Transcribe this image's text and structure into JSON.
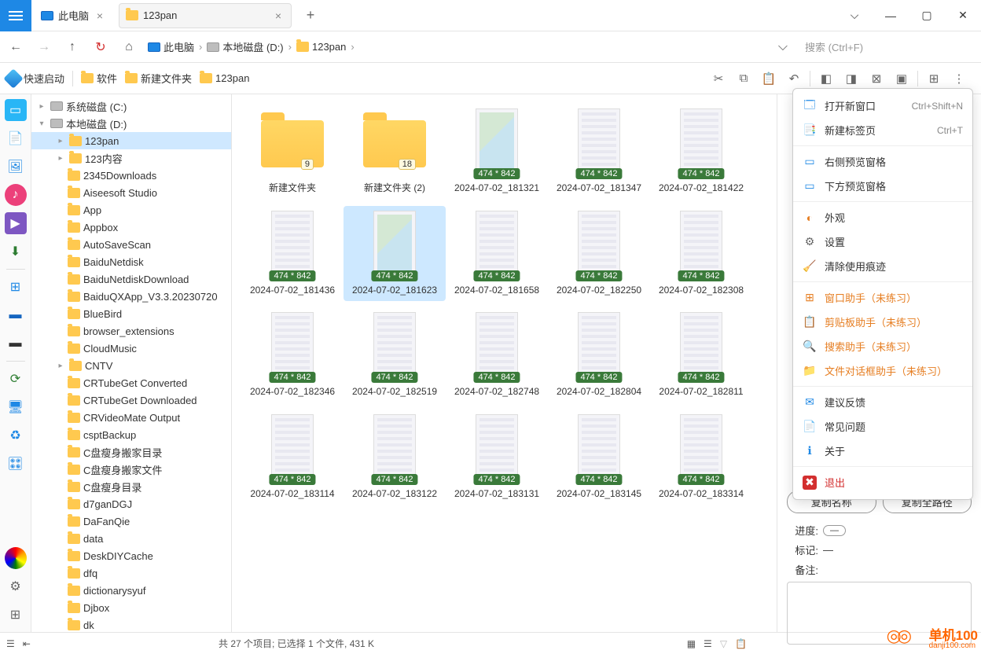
{
  "tabs": [
    {
      "label": "此电脑",
      "icon": "pc"
    },
    {
      "label": "123pan",
      "icon": "folder",
      "active": true
    }
  ],
  "nav": {
    "back": "←",
    "forward": "→",
    "up": "↑",
    "refresh": "↻",
    "home": "⌂"
  },
  "breadcrumb": [
    {
      "label": "此电脑",
      "icon": "pc"
    },
    {
      "label": "本地磁盘 (D:)",
      "icon": "disk"
    },
    {
      "label": "123pan",
      "icon": "folder"
    }
  ],
  "search_placeholder": "搜索 (Ctrl+F)",
  "quick": {
    "launch": "快速启动",
    "items": [
      "软件",
      "新建文件夹",
      "123pan"
    ]
  },
  "tree": {
    "sys_disk": "系统磁盘 (C:)",
    "local_disk": "本地磁盘 (D:)",
    "folders": [
      "123pan",
      "123内容",
      "2345Downloads",
      "Aiseesoft Studio",
      "App",
      "Appbox",
      "AutoSaveScan",
      "BaiduNetdisk",
      "BaiduNetdiskDownload",
      "BaiduQXApp_V3.3.20230720",
      "BlueBird",
      "browser_extensions",
      "CloudMusic",
      "CNTV",
      "CRTubeGet Converted",
      "CRTubeGet Downloaded",
      "CRVideoMate Output",
      "csptBackup",
      "C盘瘦身搬家目录",
      "C盘瘦身搬家文件",
      "C盘瘦身目录",
      "d7ganDGJ",
      "DaFanQie",
      "data",
      "DeskDIYCache",
      "dfq",
      "dictionarysyuf",
      "Djbox",
      "dk"
    ]
  },
  "items": [
    {
      "type": "folder",
      "name": "新建文件夹",
      "count": 9
    },
    {
      "type": "folder",
      "name": "新建文件夹 (2)",
      "count": 18
    },
    {
      "type": "img",
      "name": "2024-07-02_181321",
      "badge": "474 * 842",
      "variant": "map"
    },
    {
      "type": "img",
      "name": "2024-07-02_181347",
      "badge": "474 * 842"
    },
    {
      "type": "img",
      "name": "2024-07-02_181422",
      "badge": "474 * 842"
    },
    {
      "type": "img",
      "name": "2024-07-02_181436",
      "badge": "474 * 842"
    },
    {
      "type": "img",
      "name": "2024-07-02_181623",
      "badge": "474 * 842",
      "variant": "map",
      "selected": true
    },
    {
      "type": "img",
      "name": "2024-07-02_181658",
      "badge": "474 * 842"
    },
    {
      "type": "img",
      "name": "2024-07-02_182250",
      "badge": "474 * 842"
    },
    {
      "type": "img",
      "name": "2024-07-02_182308",
      "badge": "474 * 842"
    },
    {
      "type": "img",
      "name": "2024-07-02_182346",
      "badge": "474 * 842"
    },
    {
      "type": "img",
      "name": "2024-07-02_182519",
      "badge": "474 * 842"
    },
    {
      "type": "img",
      "name": "2024-07-02_182748",
      "badge": "474 * 842"
    },
    {
      "type": "img",
      "name": "2024-07-02_182804",
      "badge": "474 * 842"
    },
    {
      "type": "img",
      "name": "2024-07-02_182811",
      "badge": "474 * 842"
    },
    {
      "type": "img",
      "name": "2024-07-02_183114",
      "badge": "474 * 842"
    },
    {
      "type": "img",
      "name": "2024-07-02_183122",
      "badge": "474 * 842"
    },
    {
      "type": "img",
      "name": "2024-07-02_183131",
      "badge": "474 * 842"
    },
    {
      "type": "img",
      "name": "2024-07-02_183145",
      "badge": "474 * 842"
    },
    {
      "type": "img",
      "name": "2024-07-02_183314",
      "badge": "474 * 842"
    }
  ],
  "status": "共 27 个项目; 已选择 1 个文件, 431 K",
  "panel": {
    "copy_name": "复制名称",
    "copy_path": "复制全路径",
    "progress_label": "进度:",
    "progress_value": "—",
    "mark_label": "标记:",
    "mark_value": "—",
    "note_label": "备注:"
  },
  "menu": [
    {
      "icon": "🗔",
      "label": "打开新窗口",
      "shortcut": "Ctrl+Shift+N",
      "color": "#1e88e5"
    },
    {
      "icon": "📑",
      "label": "新建标签页",
      "shortcut": "Ctrl+T",
      "color": "#1e88e5"
    },
    {
      "sep": true
    },
    {
      "icon": "▭",
      "label": "右侧预览窗格",
      "color": "#1e88e5"
    },
    {
      "icon": "▭",
      "label": "下方预览窗格",
      "color": "#1e88e5"
    },
    {
      "sep": true
    },
    {
      "icon": "◐",
      "label": "外观",
      "color": "#e67e22"
    },
    {
      "icon": "⚙",
      "label": "设置",
      "color": "#666"
    },
    {
      "icon": "🧹",
      "label": "清除使用痕迹",
      "color": "#666"
    },
    {
      "sep": true
    },
    {
      "icon": "⊞",
      "label": "窗口助手（未练习）",
      "class": "orange"
    },
    {
      "icon": "📋",
      "label": "剪贴板助手（未练习）",
      "class": "orange"
    },
    {
      "icon": "🔍",
      "label": "搜索助手（未练习）",
      "class": "orange"
    },
    {
      "icon": "📁",
      "label": "文件对话框助手（未练习）",
      "class": "orange"
    },
    {
      "sep": true
    },
    {
      "icon": "✉",
      "label": "建议反馈",
      "color": "#1e88e5"
    },
    {
      "icon": "📄",
      "label": "常见问题",
      "color": "#1e88e5"
    },
    {
      "icon": "ℹ",
      "label": "关于",
      "color": "#1e88e5"
    },
    {
      "sep": true
    },
    {
      "icon": "✖",
      "label": "退出",
      "class": "red",
      "iconbg": "#d32f2f"
    }
  ],
  "watermark": {
    "big": "单机100",
    "small": "danji100.com"
  }
}
